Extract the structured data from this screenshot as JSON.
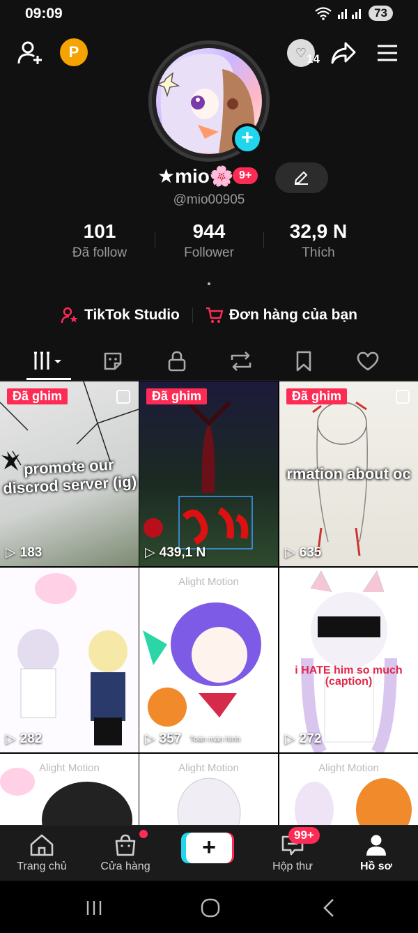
{
  "status": {
    "time": "09:09",
    "battery": "73"
  },
  "header": {
    "following_avatar_count": "14"
  },
  "profile": {
    "display_name": "★mio🌸",
    "notif_badge": "9+",
    "username": "@mio00905",
    "dot": "."
  },
  "stats": [
    {
      "value": "101",
      "label": "Đã follow"
    },
    {
      "value": "944",
      "label": "Follower"
    },
    {
      "value": "32,9 N",
      "label": "Thích"
    }
  ],
  "links": [
    {
      "label": "TikTok Studio",
      "icon": "studio-icon"
    },
    {
      "label": "Đơn hàng của bạn",
      "icon": "cart-icon"
    }
  ],
  "tabs": [
    {
      "icon": "grid-icon"
    },
    {
      "icon": "sticker-icon"
    },
    {
      "icon": "lock-icon"
    },
    {
      "icon": "repost-icon"
    },
    {
      "icon": "bookmark-icon"
    },
    {
      "icon": "heart-icon"
    }
  ],
  "videos": [
    {
      "pinned": "Đã ghim",
      "views": "183",
      "overlay": "promote our discrod server (ig)"
    },
    {
      "pinned": "Đã ghim",
      "views": "439,1 N",
      "overlay": ""
    },
    {
      "pinned": "Đã ghim",
      "views": "635",
      "overlay": "rmation about oc"
    },
    {
      "pinned": "",
      "views": "282",
      "overlay": "",
      "watermark": "Alight Motion"
    },
    {
      "pinned": "",
      "views": "357",
      "overlay": "",
      "watermark": "Alight Motion",
      "extra": "Toàn màn hình"
    },
    {
      "pinned": "",
      "views": "272",
      "overlay": "i HATE him so much (caption)"
    },
    {
      "pinned": "",
      "views": "",
      "overlay": "",
      "watermark": "Alight Motion"
    },
    {
      "pinned": "",
      "views": "",
      "overlay": "",
      "watermark": "Alight Motion"
    },
    {
      "pinned": "",
      "views": "",
      "overlay": "",
      "watermark": "Alight Motion"
    }
  ],
  "pinned_label": "Đã ghim",
  "bottom_nav": [
    {
      "label": "Trang chủ",
      "icon": "home-icon"
    },
    {
      "label": "Cửa hàng",
      "icon": "shop-icon"
    },
    {
      "label": "",
      "icon": "create-icon"
    },
    {
      "label": "Hộp thư",
      "icon": "inbox-icon"
    },
    {
      "label": "Hồ sơ",
      "icon": "profile-icon"
    }
  ],
  "inbox_badge": "99+",
  "colors": {
    "accent": "#fe2c55",
    "cyan": "#20d5ec",
    "bg": "#111111"
  }
}
